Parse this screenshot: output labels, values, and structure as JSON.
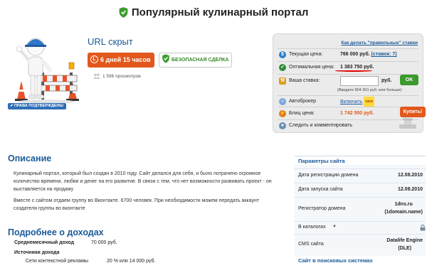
{
  "header": {
    "title": "Популярный кулинарный портал"
  },
  "lot": {
    "url_label": "URL скрыт",
    "timer": "6 дней 15 часов",
    "safe_deal": "БЕЗОПАСНАЯ СДЕЛКА",
    "views": "1 596 просмотров",
    "verified": "ПРАВА ПОДТВЕРЖДЕНЫ"
  },
  "panel": {
    "how_link": "Как делать \"правильные\" ставки",
    "current_price_label": "Текущая цена:",
    "current_price_value": "766 000 руб.",
    "bids_link": "(ставок: 7)",
    "optimal_label": "Оптимальная цена:",
    "optimal_value": "1 383 750 руб.",
    "your_bid_label": "Ваша ставка:",
    "currency": "руб.",
    "ok_label": "OK",
    "hint": "(Введите 804 301 руб. или больше)",
    "autobroker_label": "Автоброкер",
    "autobroker_link": "Включить",
    "new_tag": "NEW",
    "blitz_label": "Блиц цена:",
    "blitz_value": "1 742 500 руб.",
    "buy_label": "Купить!",
    "follow_label": "Следить и комментировать",
    "colors": {
      "accent_orange": "#e2581c",
      "price_red": "#e00000",
      "ok_green": "#3a9a2c"
    }
  },
  "description": {
    "heading": "Описание",
    "p1": "Кулинарный портал, который был создан в 2010 году. Сайт делался для себя, и было потрачено огромное количество времени, любви и денег на его развитие. В связи с тем, что нет возможности развивать проект - он выставляется на продажу",
    "p2": "Вместе с сайтом отдаем группу во Вконтакте. 6700 человек. При необходимости можем передать аккаунт создателя группы во вконтакте"
  },
  "income": {
    "heading": "Подробнее о доходах",
    "avg_label": "Среднемесячный доход",
    "avg_value": "70 000 руб.",
    "sources_label": "Источники дохода",
    "ctx_label": "Сети контекстной рекламы",
    "ctx_value": "20 % или 14 000 руб."
  },
  "params": {
    "heading": "Параметры сайта",
    "rows": [
      {
        "k": "Дата регистрации домена",
        "v": "12.08.2010"
      },
      {
        "k": "Дата запуска сайта",
        "v": "12.08.2010"
      },
      {
        "k": "Регистратор домена",
        "v": "1dns.ru\n(1domain.name)"
      },
      {
        "k": "В каталогах",
        "v": ""
      },
      {
        "k": "CMS сайта",
        "v": "Datalife Engine\n(DLE)"
      }
    ],
    "search_heading": "Сайт в поисковых системах"
  }
}
